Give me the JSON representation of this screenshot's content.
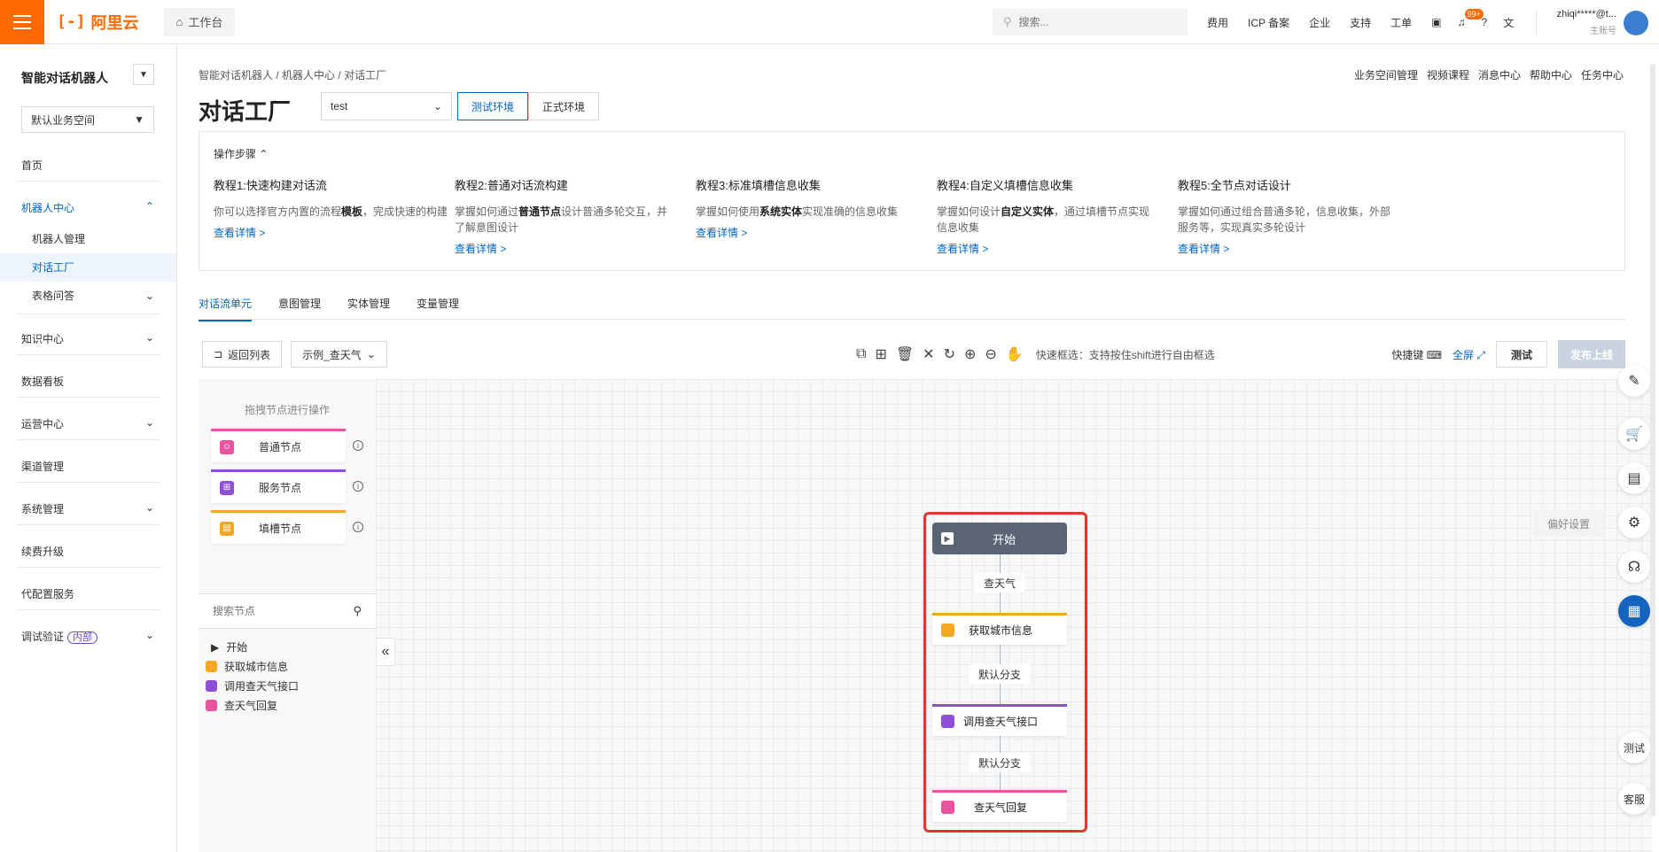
{
  "topbar": {
    "logo_text": "阿里云",
    "logo_mark": "[-]",
    "workbench": "工作台",
    "search_placeholder": "搜索...",
    "links": [
      "费用",
      "ICP 备案",
      "企业",
      "支持",
      "工单"
    ],
    "badge": "99+",
    "user_name": "zhiqi*****@t...",
    "user_sub": "主账号"
  },
  "sidebar": {
    "title": "智能对话机器人",
    "workspace": "默认业务空间",
    "home": "首页",
    "robot_center": "机器人中心",
    "robot_mgmt": "机器人管理",
    "dialog_factory": "对话工厂",
    "table_qa": "表格问答",
    "knowledge": "知识中心",
    "dashboard": "数据看板",
    "ops": "运营中心",
    "channels": "渠道管理",
    "system": "系统管理",
    "renew": "续费升级",
    "config_service": "代配置服务",
    "debug": "调试验证",
    "debug_tag": "内部"
  },
  "header": {
    "breadcrumb": [
      "智能对话机器人",
      "机器人中心",
      "对话工厂"
    ],
    "right_links": [
      "业务空间管理",
      "视频课程",
      "消息中心",
      "帮助中心",
      "任务中心"
    ],
    "title": "对话工厂",
    "app_select": "test",
    "env_test": "测试环境",
    "env_prod": "正式环境"
  },
  "steps": {
    "title": "操作步骤",
    "items": [
      {
        "title": "教程1:快速构建对话流",
        "pre": "你可以选择官方内置的流程",
        "bold": "模板",
        "post": "，完成快速的构建",
        "link": "查看详情 >"
      },
      {
        "title": "教程2:普通对话流构建",
        "pre": "掌握如何通过",
        "bold": "普通节点",
        "post": "设计普通多轮交互，并了解意图设计",
        "link": "查看详情 >"
      },
      {
        "title": "教程3:标准填槽信息收集",
        "pre": "掌握如何使用",
        "bold": "系统实体",
        "post": "实现准确的信息收集",
        "link": "查看详情 >"
      },
      {
        "title": "教程4:自定义填槽信息收集",
        "pre": "掌握如何设计",
        "bold": "自定义实体",
        "post": "，通过填槽节点实现信息收集",
        "link": "查看详情 >"
      },
      {
        "title": "教程5:全节点对话设计",
        "pre": "掌握如何通过组合普通多轮，信息收集，外部服务等，实现真实多轮设计",
        "bold": "",
        "post": "",
        "link": "查看详情 >"
      }
    ]
  },
  "tabs": [
    "对话流单元",
    "意图管理",
    "实体管理",
    "变量管理"
  ],
  "toolbar": {
    "back": "返回列表",
    "flow_select": "示例_查天气",
    "hint": "快速框选：支持按住shift进行自由框选",
    "shortcut": "快捷键",
    "fullscreen": "全屏",
    "test": "测试",
    "publish": "发布上线"
  },
  "palette": {
    "title": "拖拽节点进行操作",
    "nodes": [
      "普通节点",
      "服务节点",
      "填槽节点"
    ],
    "search_placeholder": "搜索节点",
    "tree": [
      "开始",
      "获取城市信息",
      "调用查天气接口",
      "查天气回复"
    ]
  },
  "flow": {
    "start": "开始",
    "edge1": "查天气",
    "node1": "获取城市信息",
    "edge2": "默认分支",
    "node2": "调用查天气接口",
    "edge3": "默认分支",
    "node3": "查天气回复"
  },
  "float": {
    "pref": "偏好设置",
    "test": "测试",
    "service": "客服"
  },
  "colors": {
    "accent": "#0064c8",
    "brand": "#ff6a00",
    "normal_node": "#e8549e",
    "service_node": "#8e4fd6",
    "slot_node": "#f5a623",
    "highlight": "#d83a2f"
  }
}
